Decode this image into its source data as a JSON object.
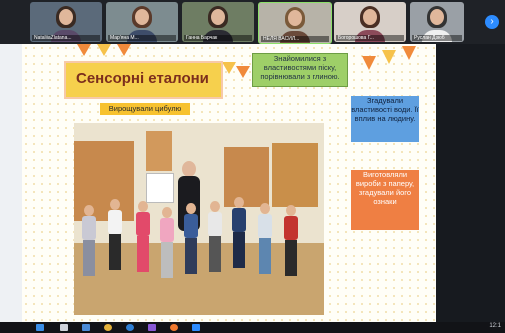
{
  "participants": [
    {
      "name": "NataliiaZlatana..."
    },
    {
      "name": "Мар'яна М..."
    },
    {
      "name": "Ганна Барчак"
    },
    {
      "name": "НЕЛЯ ВАСИЛ..."
    },
    {
      "name": "Богорошова Г..."
    },
    {
      "name": "Руслан Дзюб"
    }
  ],
  "slide": {
    "title": "Сенсорні еталони",
    "green_note": "Знайомилися з властивостями піску, порівнювали з глиною.",
    "orange_label": "Вирощували цибулю",
    "blue_note": "Згадували властивості води. Її вплив на людину.",
    "orange_note": "Виготовляли вироби з паперу, згадували його ознаки"
  },
  "taskbar": {
    "time": "12:1"
  }
}
